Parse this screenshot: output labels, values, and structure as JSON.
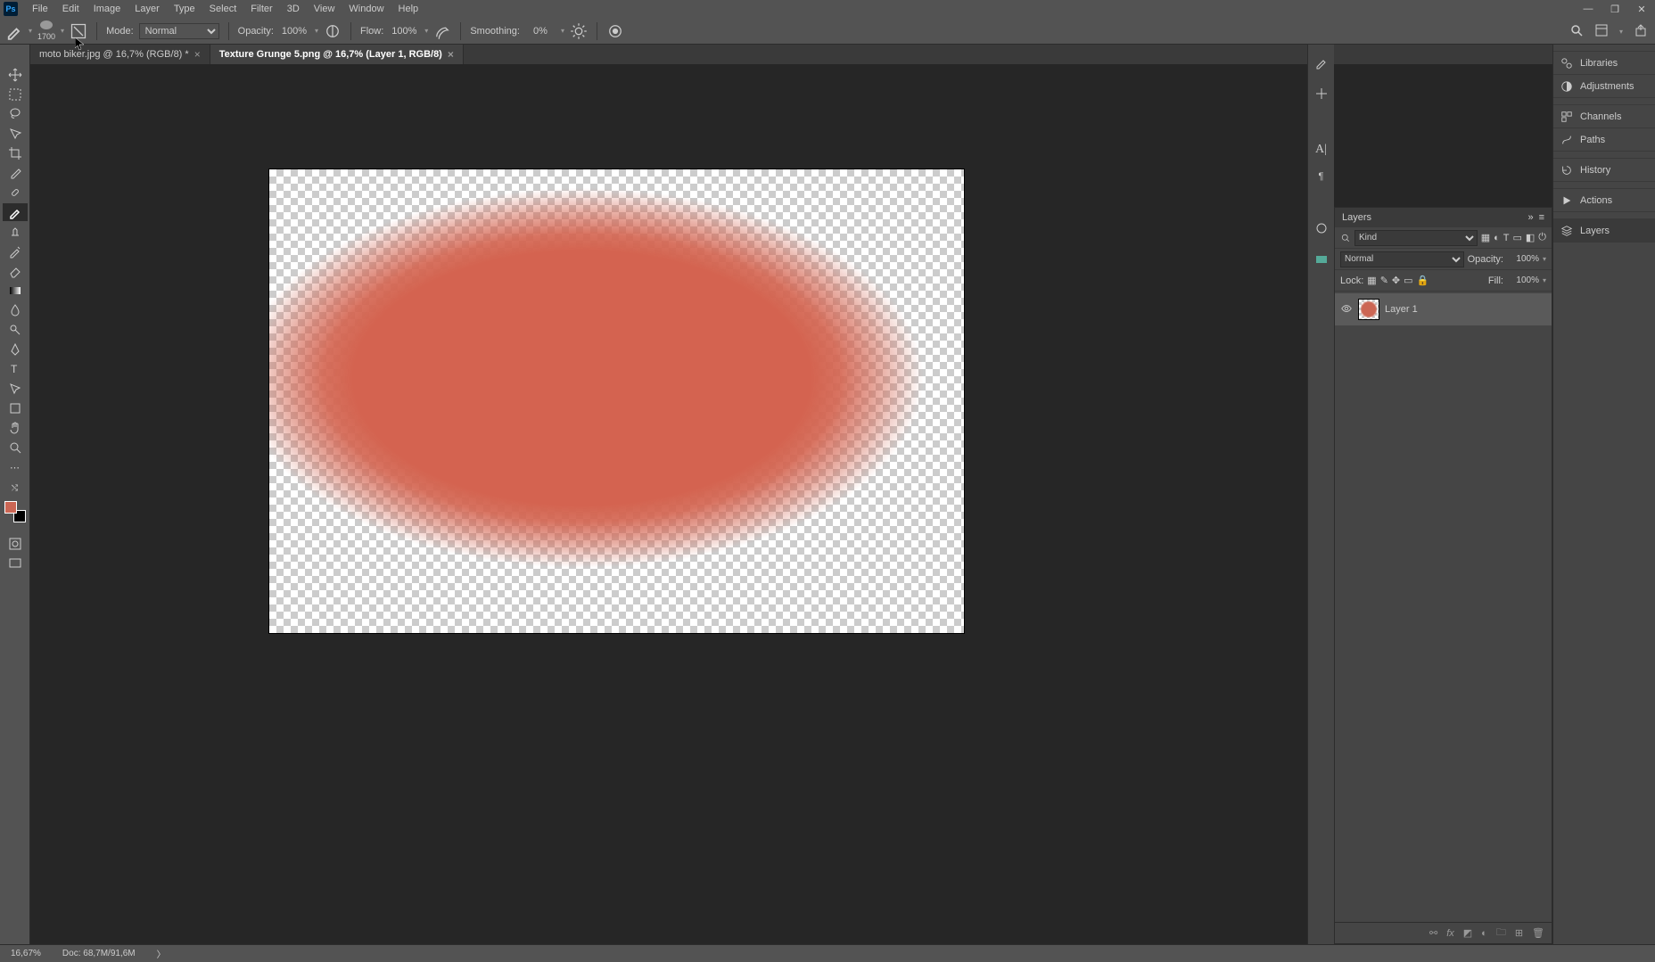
{
  "app": {
    "name": "Ps"
  },
  "menu": [
    "File",
    "Edit",
    "Image",
    "Layer",
    "Type",
    "Select",
    "Filter",
    "3D",
    "View",
    "Window",
    "Help"
  ],
  "options": {
    "brush_size": "1700",
    "mode_label": "Mode:",
    "mode_value": "Normal",
    "opacity_label": "Opacity:",
    "opacity_value": "100%",
    "flow_label": "Flow:",
    "flow_value": "100%",
    "smoothing_label": "Smoothing:",
    "smoothing_value": "0%"
  },
  "tabs": [
    {
      "title": "moto biker.jpg @ 16,7% (RGB/8) *",
      "active": false
    },
    {
      "title": "Texture Grunge 5.png @ 16,7% (Layer 1, RGB/8)",
      "active": true
    }
  ],
  "status": {
    "zoom": "16,67%",
    "doc": "Doc: 68,7M/91,6M"
  },
  "layers_panel": {
    "title": "Layers",
    "filter_label": "Kind",
    "blend_mode": "Normal",
    "opacity_label": "Opacity:",
    "opacity_value": "100%",
    "lock_label": "Lock:",
    "fill_label": "Fill:",
    "fill_value": "100%",
    "layer": {
      "name": "Layer 1"
    }
  },
  "right_tabs": [
    "Libraries",
    "Adjustments",
    "Channels",
    "Paths",
    "History",
    "Actions",
    "Layers"
  ],
  "colors": {
    "foreground": "#cc6654",
    "background": "#000000"
  }
}
